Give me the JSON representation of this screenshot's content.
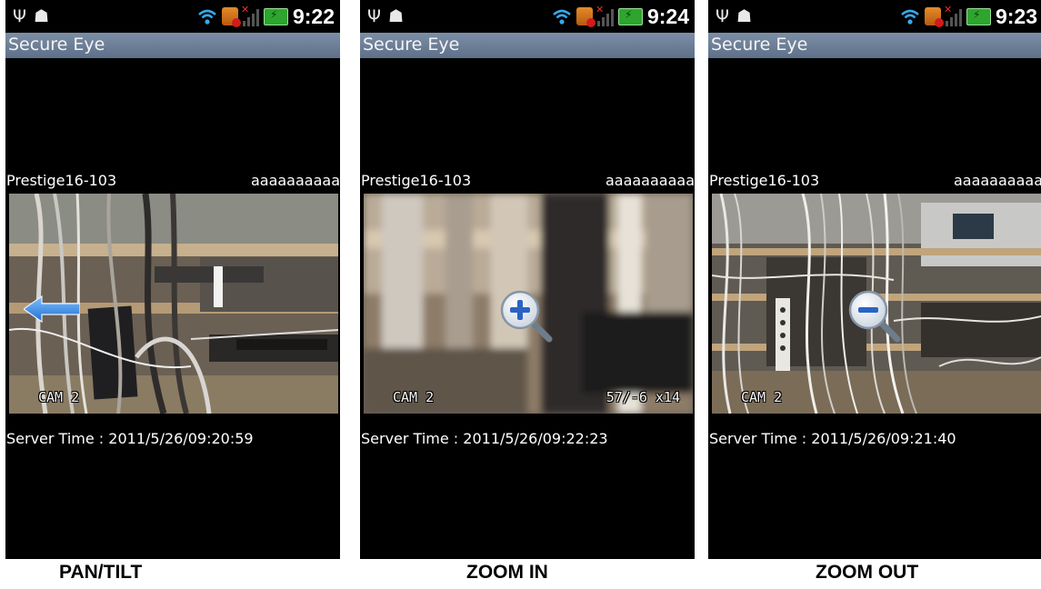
{
  "app": {
    "title": "Secure Eye",
    "camera_name": "Prestige16-103",
    "camera_user": "aaaaaaaaaa",
    "server_time_label": "Server Time : "
  },
  "panels": [
    {
      "clock": "9:22",
      "server_time": "2011/5/26/09:20:59",
      "osd_left": "CAM 2",
      "osd_right": "",
      "overlay_icon": "left-arrow-icon",
      "caption": "PAN/TILT"
    },
    {
      "clock": "9:24",
      "server_time": "2011/5/26/09:22:23",
      "osd_left": "CAM 2",
      "osd_right": "57/-6 x14",
      "overlay_icon": "zoom-in-icon",
      "caption": "ZOOM IN"
    },
    {
      "clock": "9:23",
      "server_time": "2011/5/26/09:21:40",
      "osd_left": "CAM 2",
      "osd_right": "",
      "overlay_icon": "zoom-out-icon",
      "caption": "ZOOM OUT"
    }
  ],
  "colors": {
    "titlebar": "#6e809a",
    "arrow": "#3b8fe0",
    "battery": "#2ea52e"
  }
}
